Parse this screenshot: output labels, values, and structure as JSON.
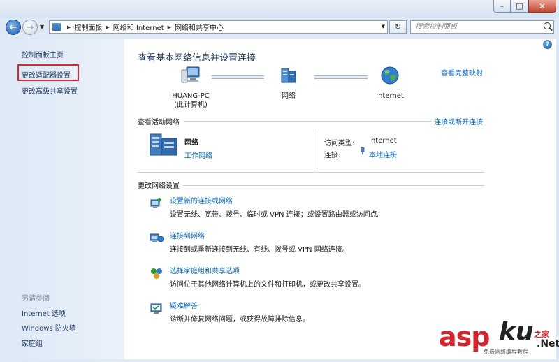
{
  "window": {
    "minimize_glyph": "–",
    "maximize_glyph": "□",
    "close_glyph": "✕"
  },
  "address_bar": {
    "breadcrumbs": [
      "控制面板",
      "网络和 Internet",
      "网络和共享中心"
    ],
    "search_placeholder": "搜索控制面板"
  },
  "sidebar": {
    "items": [
      {
        "label": "控制面板主页"
      },
      {
        "label": "更改适配器设置"
      },
      {
        "label": "更改高级共享设置"
      }
    ],
    "see_also_title": "另请参阅",
    "see_also": [
      {
        "label": "Internet 选项"
      },
      {
        "label": "Windows 防火墙"
      },
      {
        "label": "家庭组"
      }
    ]
  },
  "main": {
    "help_glyph": "?",
    "title": "查看基本网络信息并设置连接",
    "view_full_map": "查看完整映射",
    "map": {
      "computer_name": "HUANG-PC",
      "computer_sub": "(此计算机)",
      "network_label": "网络",
      "internet_label": "Internet"
    },
    "active_networks": {
      "header": "查看活动网络",
      "connect_disconnect": "连接或断开连接",
      "network_name": "网络",
      "network_type": "工作网络",
      "access_type_label": "访问类型:",
      "access_type_value": "Internet",
      "connections_label": "连接:",
      "connections_value": "本地连接"
    },
    "change_settings": {
      "header": "更改网络设置",
      "tasks": [
        {
          "link": "设置新的连接或网络",
          "desc": "设置无线、宽带、拨号、临时或 VPN 连接；或设置路由器或访问点。"
        },
        {
          "link": "连接到网络",
          "desc": "连接到或重新连接到无线、有线、拨号或 VPN 网络连接。"
        },
        {
          "link": "选择家庭组和共享选项",
          "desc": "访问位于其他网络计算机上的文件和打印机，或更改共享设置。"
        },
        {
          "link": "疑难解答",
          "desc": "诊断并修复网络问题，或获得故障排除信息。"
        }
      ]
    }
  },
  "watermark": {
    "brand": "asp",
    "ku": "ku",
    "cn": "之家",
    "net": ".Net",
    "sub": "免费网络编程教程"
  },
  "colors": {
    "link": "#0066cc",
    "title": "#1e395b",
    "highlight_box": "#e0262a",
    "watermark_red": "#d8232a"
  }
}
